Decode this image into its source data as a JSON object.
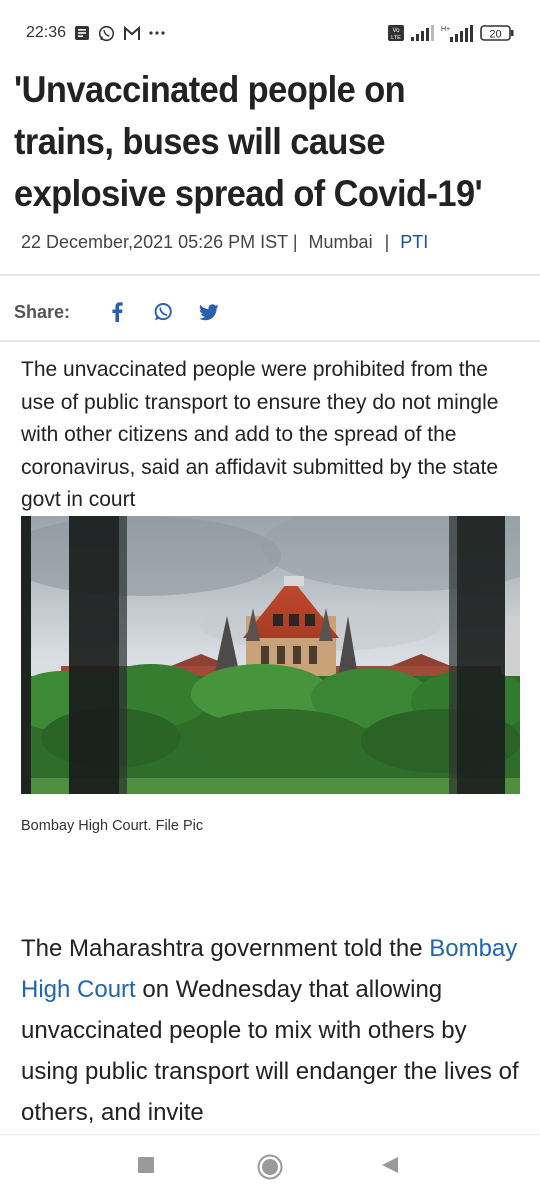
{
  "status_bar": {
    "time": "22:36",
    "notification_icons": [
      "news-icon",
      "whatsapp-icon",
      "gmail-icon",
      "more-icon"
    ],
    "network_badge": "Vo LTE",
    "signal_label": "H+",
    "battery": "20"
  },
  "article": {
    "headline": "'Unvaccinated people on trains, buses will cause explosive spread of Covid-19'",
    "date": "22 December,2021 05:26 PM IST",
    "location": "Mumbai",
    "source": "PTI",
    "separator": "|",
    "share_label": "Share:",
    "share_icons": [
      "facebook-icon",
      "whatsapp-icon",
      "twitter-icon"
    ],
    "summary": "The unvaccinated people were prohibited from the use of public transport to ensure they do not mingle with other citizens and add to the spread of the coronavirus, said an affidavit submitted by the state govt in court",
    "image_caption": "Bombay High Court. File Pic",
    "body_before_link": "The Maharashtra government told the",
    "body_link": "Bombay High Court",
    "body_after_link": "on Wednesday that allowing unvaccinated people to mix with others by using public transport will endanger the lives of others, and invite"
  },
  "nav_bar": {
    "icons": [
      "recents-square-icon",
      "home-circle-icon",
      "back-triangle-icon"
    ]
  },
  "colors": {
    "link": "#1e66b0",
    "source": "#1a4f9c",
    "share_icon": "#2b5fb3",
    "text": "#222222"
  }
}
